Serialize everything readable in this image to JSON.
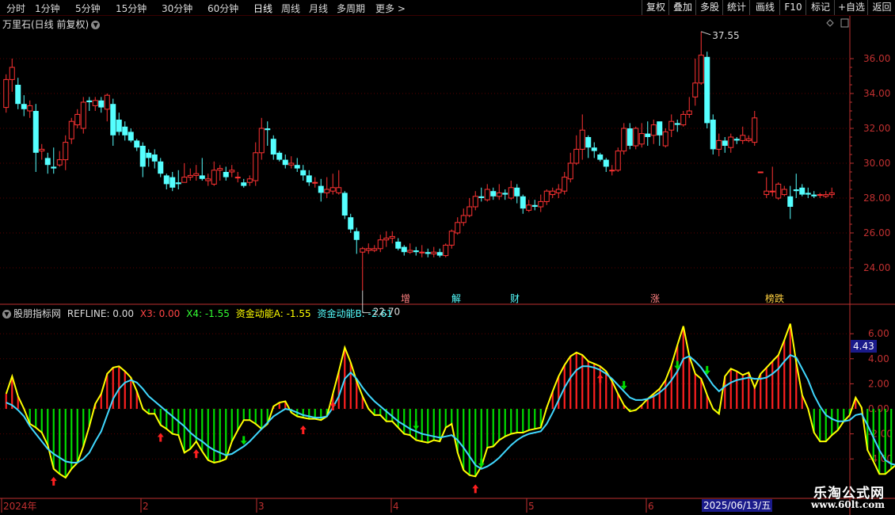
{
  "toolbar": {
    "left": [
      "分时",
      "1分钟",
      "5分钟",
      "15分钟",
      "30分钟",
      "60分钟",
      "日线",
      "周线",
      "月线",
      "多周期",
      "更多"
    ],
    "more_arrow": ">",
    "right": [
      "复权",
      "叠加",
      "多股",
      "统计",
      "画线",
      "F10",
      "+自选",
      "返回"
    ]
  },
  "main": {
    "title": "万里石(日线 前复权)",
    "y_ticks": [
      "36.00",
      "34.00",
      "32.00",
      "30.00",
      "28.00",
      "26.00",
      "24.00"
    ],
    "max_label": "37.55",
    "min_label": "22.70",
    "events": [
      "增",
      "解",
      "财",
      "涨",
      "榜跌"
    ]
  },
  "indicator": {
    "name": "股朋指标网",
    "refline": "REFLINE: 0.00",
    "x3": "X3: 0.00",
    "x4": "X4: -1.55",
    "a": "资金动能A: -1.55",
    "b": "资金动能B: -2.61",
    "y_ticks": [
      "6.00",
      "4.00",
      "2.00",
      "0.00",
      "-2.00",
      "-4.00"
    ],
    "current_value": "4.43"
  },
  "x_axis": {
    "labels": [
      "2024年",
      "2",
      "3",
      "4",
      "5",
      "6"
    ],
    "cursor_date": "2025/06/13/五"
  },
  "watermark": {
    "line1": "乐淘公式网",
    "line2": "www.60lt.com"
  },
  "colors": {
    "up": "#ff3333",
    "down": "#55ffff",
    "green": "#00dd00",
    "yellow": "#ffff00",
    "axis": "#c03030"
  },
  "chart_data": {
    "type": "candlestick",
    "y_range": [
      23,
      37.5
    ],
    "candles": [
      [
        33.2,
        34.8,
        32.9,
        35.1
      ],
      [
        34.8,
        35.5,
        34.1,
        36.0
      ],
      [
        34.5,
        33.4,
        33.1,
        34.9
      ],
      [
        33.4,
        33.1,
        32.7,
        33.9
      ],
      [
        33.0,
        33.3,
        32.6,
        33.6
      ],
      [
        33.0,
        30.6,
        29.5,
        33.4
      ],
      [
        30.7,
        30.8,
        30.2,
        31.1
      ],
      [
        30.3,
        29.9,
        29.4,
        30.6
      ],
      [
        29.8,
        29.7,
        29.4,
        30.9
      ],
      [
        29.9,
        30.2,
        29.8,
        30.7
      ],
      [
        30.2,
        31.2,
        29.6,
        31.6
      ],
      [
        31.4,
        32.4,
        31.1,
        32.6
      ],
      [
        32.2,
        32.8,
        32.0,
        33.1
      ],
      [
        32.0,
        33.5,
        31.7,
        33.8
      ],
      [
        33.6,
        33.5,
        33.0,
        33.8
      ],
      [
        33.3,
        33.6,
        33.0,
        33.8
      ],
      [
        33.6,
        33.2,
        32.9,
        33.8
      ],
      [
        33.1,
        33.9,
        32.4,
        34.0
      ],
      [
        33.4,
        31.6,
        31.0,
        33.7
      ],
      [
        32.5,
        31.8,
        31.6,
        32.9
      ],
      [
        32.1,
        31.6,
        31.3,
        32.4
      ],
      [
        31.8,
        31.3,
        31.2,
        32.0
      ],
      [
        31.3,
        30.9,
        30.7,
        31.4
      ],
      [
        31.0,
        29.8,
        29.2,
        31.2
      ],
      [
        30.6,
        30.3,
        29.8,
        30.8
      ],
      [
        30.5,
        30.1,
        29.7,
        30.8
      ],
      [
        30.1,
        29.4,
        29.2,
        30.3
      ],
      [
        29.3,
        28.8,
        28.5,
        29.4
      ],
      [
        29.2,
        28.6,
        28.4,
        29.5
      ],
      [
        28.9,
        28.8,
        28.5,
        29.6
      ],
      [
        28.9,
        29.2,
        28.9,
        30.0
      ],
      [
        29.2,
        29.3,
        29.0,
        29.7
      ],
      [
        29.3,
        29.4,
        29.0,
        29.9
      ],
      [
        29.3,
        29.1,
        29.0,
        30.3
      ],
      [
        29.0,
        29.1,
        28.7,
        29.4
      ],
      [
        28.8,
        29.6,
        28.7,
        30.1
      ],
      [
        29.6,
        29.7,
        29.0,
        29.9
      ],
      [
        29.5,
        29.2,
        29.0,
        29.8
      ],
      [
        29.5,
        29.6,
        29.2,
        29.9
      ],
      [
        29.2,
        29.2,
        28.9,
        29.5
      ],
      [
        28.9,
        28.7,
        28.6,
        29.1
      ],
      [
        28.9,
        29.1,
        28.7,
        29.3
      ],
      [
        29.0,
        30.6,
        28.7,
        31.2
      ],
      [
        30.6,
        32.0,
        30.2,
        32.6
      ],
      [
        32.0,
        31.9,
        31.0,
        32.4
      ],
      [
        31.4,
        30.5,
        30.2,
        31.6
      ],
      [
        30.6,
        30.2,
        30.1,
        30.7
      ],
      [
        30.2,
        29.9,
        29.7,
        30.5
      ],
      [
        29.9,
        30.0,
        29.7,
        30.4
      ],
      [
        29.9,
        29.7,
        29.5,
        30.3
      ],
      [
        29.6,
        29.3,
        29.0,
        29.9
      ],
      [
        29.3,
        28.9,
        28.7,
        29.6
      ],
      [
        28.9,
        28.9,
        28.6,
        29.2
      ],
      [
        28.7,
        28.3,
        27.8,
        29.1
      ],
      [
        28.3,
        28.5,
        28.0,
        29.2
      ],
      [
        28.4,
        28.6,
        28.2,
        29.4
      ],
      [
        28.3,
        28.6,
        28.2,
        29.6
      ],
      [
        28.3,
        27.0,
        26.8,
        28.4
      ],
      [
        26.9,
        26.2,
        26.0,
        27.1
      ],
      [
        26.1,
        25.6,
        24.8,
        26.3
      ],
      [
        24.9,
        25.1,
        22.7,
        25.2
      ],
      [
        25.0,
        25.1,
        24.8,
        25.4
      ],
      [
        25.0,
        25.1,
        24.9,
        25.3
      ],
      [
        25.1,
        25.6,
        24.9,
        25.9
      ],
      [
        25.6,
        25.7,
        25.2,
        26.1
      ],
      [
        25.7,
        25.8,
        25.4,
        26.1
      ],
      [
        25.5,
        25.1,
        25.0,
        25.7
      ],
      [
        25.2,
        24.9,
        24.7,
        25.3
      ],
      [
        24.9,
        25.0,
        24.8,
        25.4
      ],
      [
        25.0,
        24.9,
        24.7,
        25.2
      ],
      [
        24.9,
        24.9,
        24.6,
        25.3
      ],
      [
        24.9,
        24.8,
        24.6,
        25.1
      ],
      [
        24.8,
        24.9,
        24.6,
        25.2
      ],
      [
        24.9,
        24.7,
        24.6,
        25.1
      ],
      [
        24.7,
        25.3,
        24.6,
        25.4
      ],
      [
        25.3,
        26.1,
        25.1,
        26.2
      ],
      [
        26.0,
        26.6,
        25.9,
        26.9
      ],
      [
        26.6,
        27.0,
        26.4,
        27.4
      ],
      [
        27.0,
        27.5,
        26.9,
        28.0
      ],
      [
        27.5,
        28.1,
        27.3,
        28.4
      ],
      [
        28.1,
        28.0,
        27.8,
        28.6
      ],
      [
        27.9,
        28.5,
        27.8,
        28.8
      ],
      [
        28.4,
        28.1,
        27.9,
        28.6
      ],
      [
        28.1,
        28.3,
        27.9,
        28.8
      ],
      [
        28.3,
        28.2,
        27.9,
        28.5
      ],
      [
        28.0,
        28.6,
        27.9,
        29.0
      ],
      [
        28.6,
        28.1,
        27.7,
        28.8
      ],
      [
        28.1,
        27.4,
        27.1,
        28.2
      ],
      [
        27.3,
        27.6,
        27.2,
        27.9
      ],
      [
        27.6,
        27.5,
        27.3,
        27.9
      ],
      [
        27.5,
        27.8,
        27.2,
        28.2
      ],
      [
        27.8,
        28.4,
        27.6,
        28.5
      ],
      [
        28.2,
        28.4,
        28.0,
        28.6
      ],
      [
        28.3,
        28.5,
        28.0,
        28.8
      ],
      [
        28.4,
        29.2,
        28.2,
        29.5
      ],
      [
        29.1,
        30.0,
        28.9,
        30.6
      ],
      [
        30.0,
        30.8,
        29.9,
        31.6
      ],
      [
        30.8,
        31.9,
        30.2,
        32.8
      ],
      [
        31.5,
        30.9,
        30.3,
        31.6
      ],
      [
        30.9,
        30.7,
        30.3,
        31.2
      ],
      [
        30.5,
        30.2,
        30.1,
        30.6
      ],
      [
        30.2,
        29.8,
        29.5,
        30.3
      ],
      [
        29.6,
        29.6,
        29.3,
        29.9
      ],
      [
        29.6,
        30.7,
        29.5,
        30.9
      ],
      [
        30.7,
        32.0,
        30.5,
        32.3
      ],
      [
        32.0,
        31.0,
        30.8,
        32.3
      ],
      [
        31.0,
        32.0,
        30.8,
        32.1
      ],
      [
        31.1,
        31.7,
        30.9,
        32.3
      ],
      [
        31.7,
        31.5,
        31.0,
        32.4
      ],
      [
        31.6,
        32.2,
        31.1,
        32.5
      ],
      [
        32.4,
        31.6,
        31.0,
        32.3
      ],
      [
        31.0,
        31.8,
        30.9,
        32.0
      ],
      [
        31.9,
        32.4,
        31.5,
        32.8
      ],
      [
        32.3,
        32.2,
        31.8,
        32.5
      ],
      [
        32.2,
        32.8,
        32.1,
        33.0
      ],
      [
        32.8,
        33.0,
        32.6,
        33.8
      ],
      [
        33.8,
        34.6,
        33.3,
        36.0
      ],
      [
        34.6,
        36.2,
        34.5,
        37.55
      ],
      [
        36.1,
        32.3,
        32.0,
        36.4
      ],
      [
        32.5,
        30.8,
        30.5,
        32.8
      ],
      [
        30.8,
        31.3,
        30.4,
        31.7
      ],
      [
        31.3,
        31.0,
        30.6,
        31.5
      ],
      [
        30.9,
        31.5,
        30.6,
        31.7
      ],
      [
        31.4,
        31.3,
        31.1,
        31.5
      ],
      [
        31.3,
        31.6,
        31.1,
        32.1
      ],
      [
        31.3,
        31.4,
        31.2,
        31.6
      ],
      [
        31.2,
        32.6,
        31.0,
        33.0
      ],
      [
        29.5,
        29.5,
        29.5,
        29.5
      ],
      [
        28.2,
        28.4,
        28.0,
        29.2
      ],
      [
        28.4,
        28.4,
        28.1,
        29.8
      ],
      [
        28.0,
        28.8,
        27.9,
        28.9
      ],
      [
        28.2,
        28.5,
        28.1,
        28.7
      ],
      [
        28.1,
        27.5,
        26.8,
        28.7
      ],
      [
        28.5,
        28.4,
        28.0,
        29.4
      ],
      [
        28.6,
        28.2,
        28.1,
        28.8
      ],
      [
        28.3,
        28.2,
        28.0,
        28.6
      ],
      [
        28.2,
        28.1,
        28.0,
        28.4
      ],
      [
        28.2,
        28.2,
        28.0,
        28.3
      ],
      [
        28.1,
        28.2,
        28.0,
        28.4
      ],
      [
        28.2,
        28.3,
        28.0,
        28.6
      ]
    ],
    "indicator_ylim": [
      -5.5,
      7.2
    ],
    "hist": [
      1.2,
      2.6,
      1.0,
      0.0,
      -1.2,
      -1.5,
      -1.9,
      -2.9,
      -4.8,
      -5.2,
      -5.5,
      -4.8,
      -4.3,
      -3.0,
      -1.4,
      0.4,
      1.2,
      2.8,
      3.3,
      3.4,
      3.0,
      2.5,
      1.4,
      0.0,
      -0.4,
      -0.4,
      -1.3,
      -1.6,
      -2.0,
      -2.1,
      -3.5,
      -3.2,
      -2.6,
      -3.4,
      -4.1,
      -4.3,
      -4.2,
      -4.0,
      -2.6,
      -1.7,
      -0.9,
      -0.9,
      -1.2,
      -1.6,
      -1.2,
      0.2,
      0.5,
      0.6,
      -0.3,
      -0.6,
      -0.7,
      -0.8,
      -0.8,
      -0.9,
      -0.6,
      1.2,
      3.0,
      4.9,
      3.7,
      2.2,
      1.0,
      0.0,
      -0.5,
      -0.5,
      -1.0,
      -1.0,
      -1.5,
      -2.0,
      -2.1,
      -2.5,
      -2.6,
      -2.7,
      -2.5,
      -2.6,
      -1.5,
      -1.2,
      -3.5,
      -4.9,
      -5.3,
      -5.4,
      -4.6,
      -3.1,
      -3.0,
      -2.5,
      -2.2,
      -2.0,
      -1.9,
      -1.9,
      -1.7,
      -1.6,
      -1.5,
      0.1,
      1.4,
      2.6,
      3.5,
      4.2,
      4.5,
      4.3,
      3.8,
      3.6,
      3.4,
      3.0,
      2.2,
      1.2,
      0.3,
      -0.2,
      -0.1,
      0.3,
      0.8,
      1.2,
      1.6,
      2.3,
      3.5,
      5.1,
      6.6,
      4.2,
      2.8,
      2.4,
      1.1,
      0.0,
      -0.4,
      2.6,
      3.2,
      3.0,
      2.7,
      2.9,
      1.7,
      2.8,
      3.3,
      3.8,
      4.3,
      5.5,
      6.8,
      3.7,
      1.1,
      0.0,
      -1.9,
      -2.6,
      -2.6,
      -2.1,
      -1.7,
      -1.0,
      -0.5,
      0.9,
      0.1,
      -3.3,
      -4.2,
      -5.2,
      -5.2,
      -4.8,
      -4.4,
      -4.0,
      -3.6,
      -3.2,
      -2.8,
      -2.5,
      -2.2,
      -2.0,
      -1.8,
      -1.6
    ],
    "line_b": [
      0.5,
      0.3,
      -0.1,
      -0.6,
      -1.4,
      -2.0,
      -2.6,
      -3.2,
      -3.6,
      -3.9,
      -4.2,
      -4.3,
      -4.3,
      -4.0,
      -3.5,
      -2.6,
      -1.8,
      -0.5,
      0.8,
      1.6,
      2.1,
      2.3,
      2.1,
      1.6,
      1.0,
      0.6,
      0.2,
      -0.2,
      -0.6,
      -1.0,
      -1.4,
      -1.9,
      -2.3,
      -2.6,
      -3.0,
      -3.3,
      -3.5,
      -3.7,
      -3.6,
      -3.3,
      -3.0,
      -2.6,
      -2.1,
      -1.6,
      -1.1,
      -0.6,
      -0.3,
      0.0,
      -0.1,
      -0.3,
      -0.5,
      -0.6,
      -0.7,
      -0.7,
      -0.6,
      0.1,
      1.0,
      2.4,
      2.9,
      2.4,
      1.7,
      1.1,
      0.6,
      0.2,
      -0.2,
      -0.6,
      -1.0,
      -1.3,
      -1.6,
      -1.8,
      -2.0,
      -2.1,
      -2.2,
      -2.3,
      -2.2,
      -2.1,
      -2.5,
      -3.1,
      -3.8,
      -4.5,
      -4.8,
      -4.6,
      -4.3,
      -3.9,
      -3.4,
      -2.9,
      -2.5,
      -2.2,
      -2.0,
      -1.9,
      -1.8,
      -1.2,
      -0.3,
      0.7,
      1.7,
      2.5,
      3.1,
      3.4,
      3.4,
      3.3,
      3.1,
      2.8,
      2.4,
      1.9,
      1.4,
      0.9,
      0.7,
      0.7,
      0.8,
      1.0,
      1.3,
      1.7,
      2.3,
      3.0,
      4.0,
      4.2,
      3.8,
      3.3,
      2.6,
      1.9,
      1.4,
      1.8,
      2.1,
      2.3,
      2.4,
      2.5,
      2.4,
      2.4,
      2.5,
      2.8,
      3.2,
      3.8,
      4.3,
      4.1,
      3.2,
      2.3,
      1.1,
      0.2,
      -0.5,
      -0.8,
      -1.0,
      -1.0,
      -0.9,
      -0.5,
      -0.4,
      -1.3,
      -2.3,
      -3.3,
      -4.1,
      -4.4,
      -4.5,
      -4.4,
      -4.2,
      -4.0,
      -3.8,
      -3.6,
      -3.3,
      -3.0,
      -2.7,
      -2.3
    ],
    "up_arrows": [
      8,
      26,
      32,
      50,
      55,
      79,
      100,
      151
    ],
    "down_arrows": [
      40,
      69,
      80,
      104,
      113,
      118
    ]
  }
}
